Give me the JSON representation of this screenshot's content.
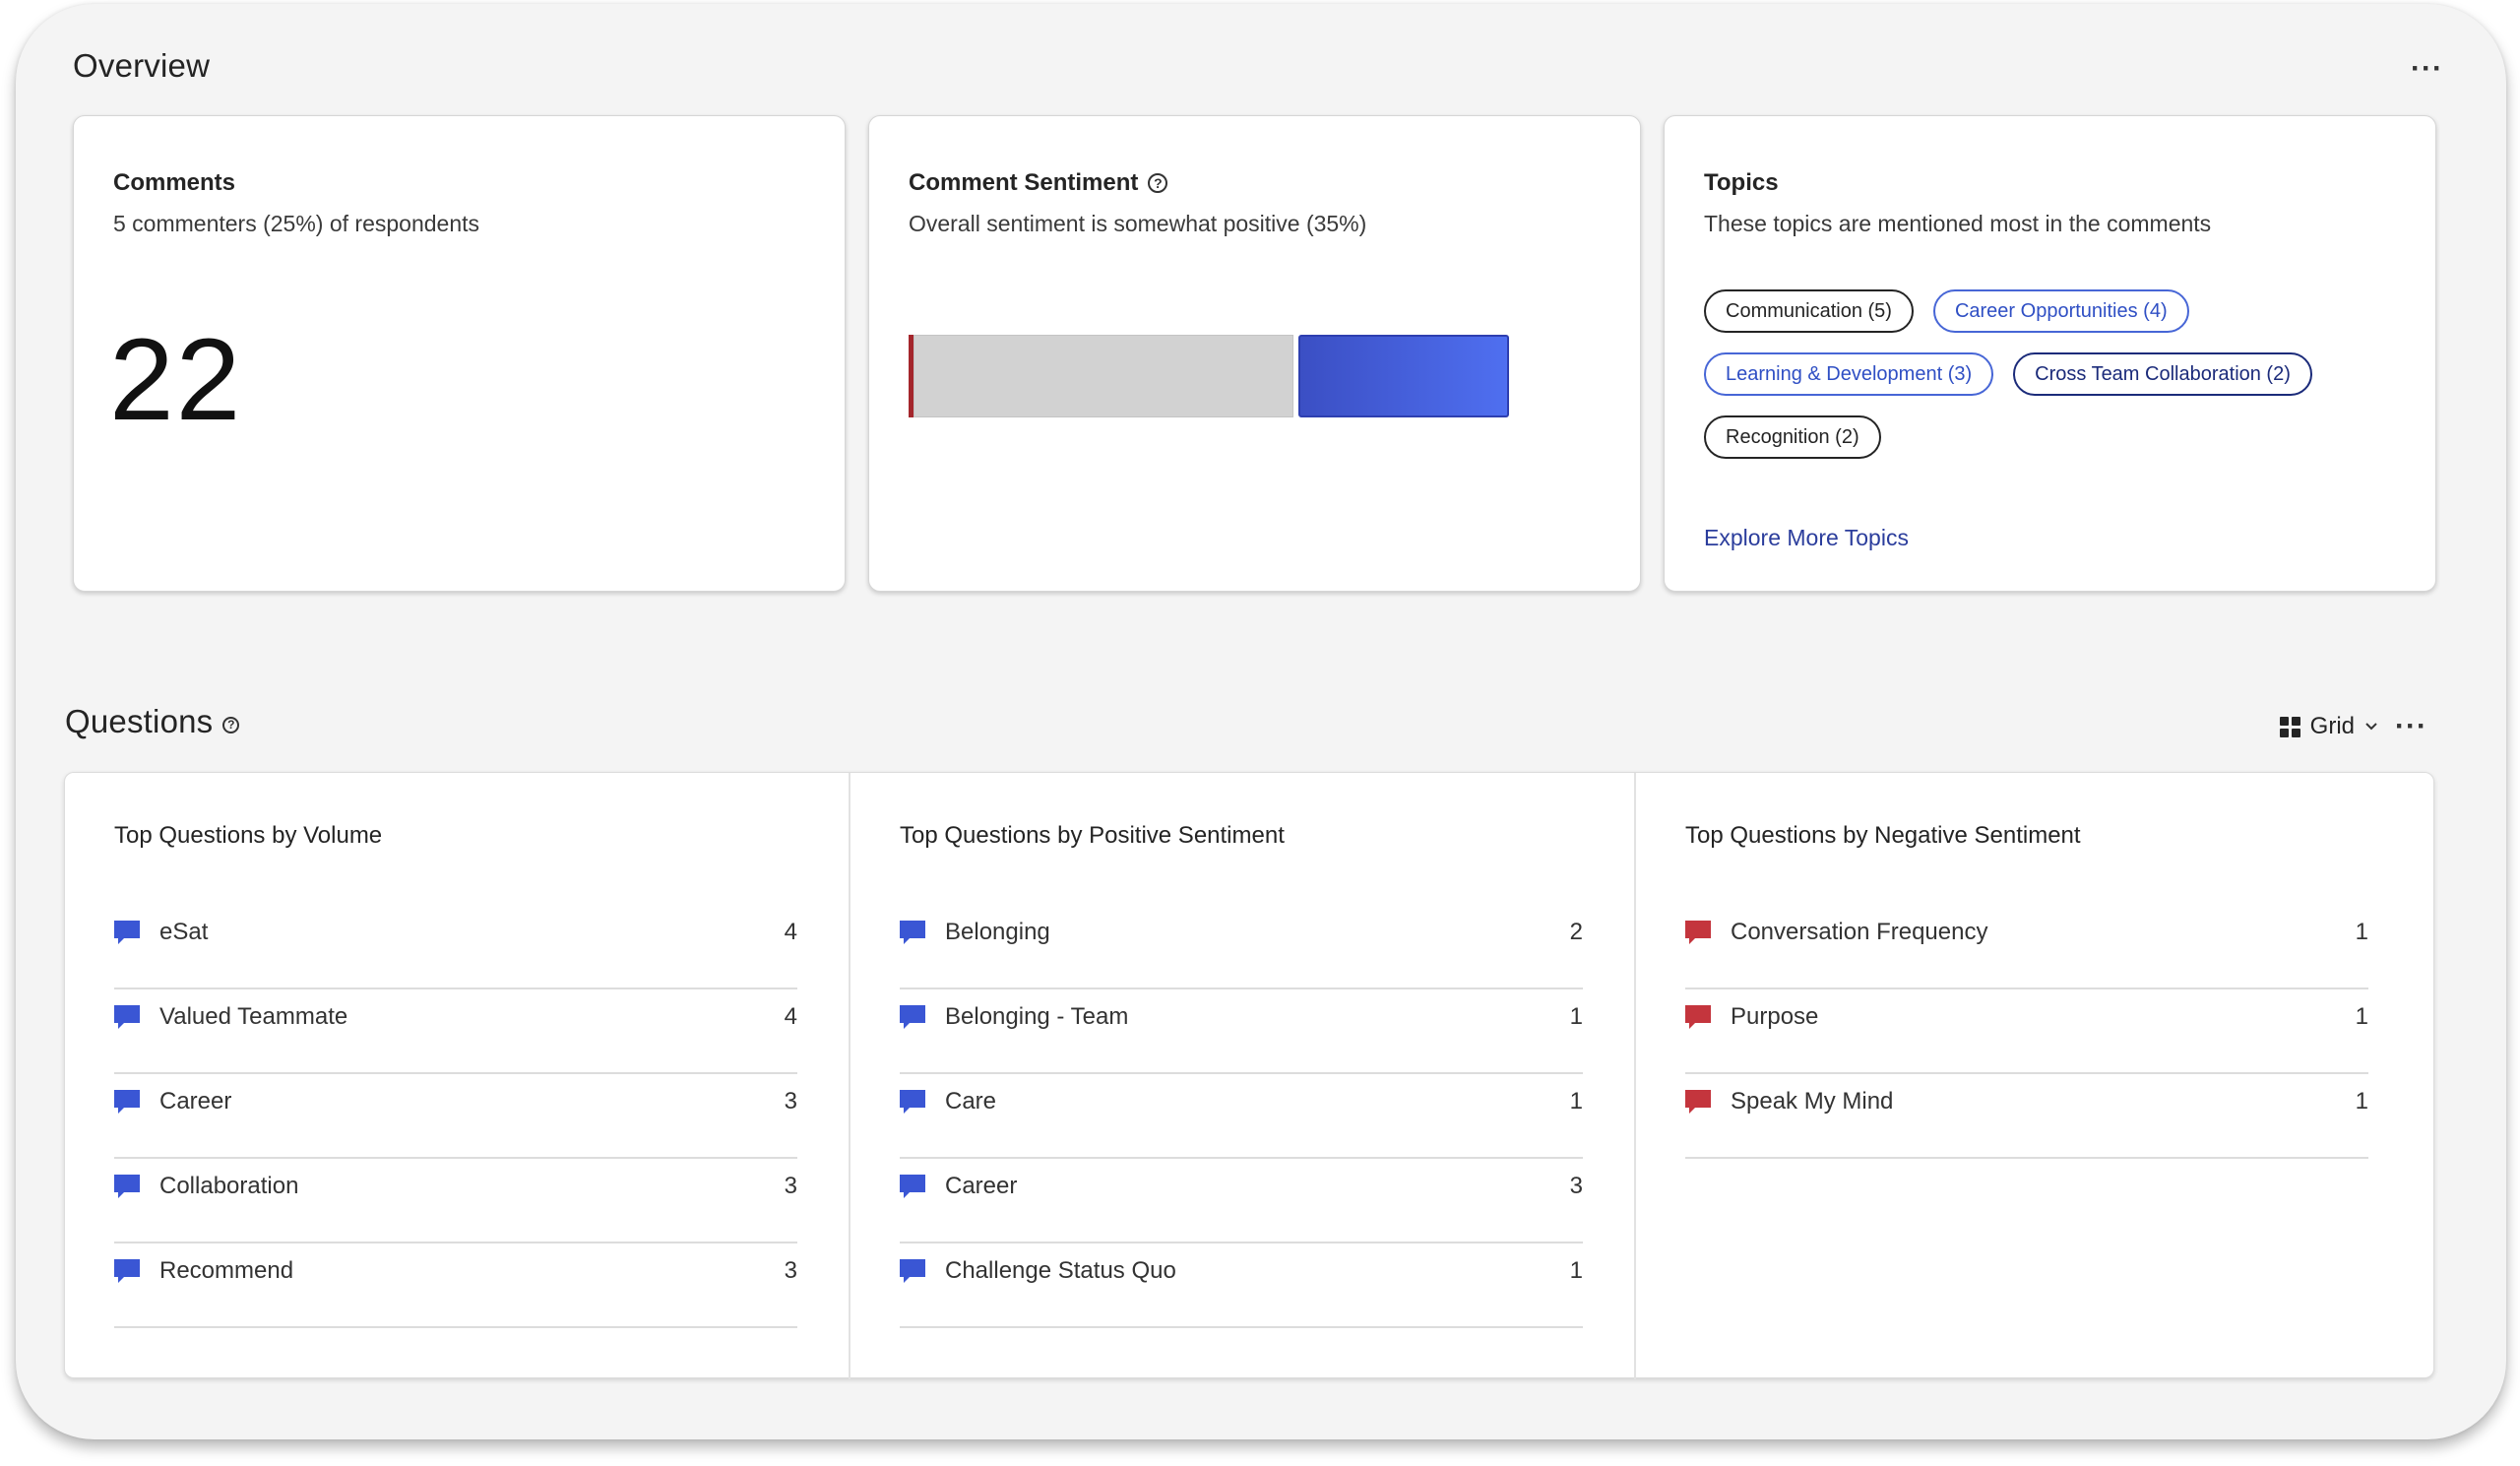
{
  "overview": {
    "title": "Overview",
    "more_label": "···"
  },
  "comments_card": {
    "title": "Comments",
    "subtitle": "5 commenters (25%) of respondents",
    "count": "22"
  },
  "sentiment_card": {
    "title": "Comment Sentiment",
    "help": "?",
    "subtitle": "Overall sentiment is somewhat positive (35%)",
    "bar_colors": {
      "negative": "#a4262c",
      "neutral": "#d2d2d2",
      "positive": "#4a63e0"
    }
  },
  "topics_card": {
    "title": "Topics",
    "subtitle": "These topics are mentioned most in the comments",
    "chips": [
      {
        "label": "Communication (5)",
        "style": "dark"
      },
      {
        "label": "Career Opportunities (4)",
        "style": "blue"
      },
      {
        "label": "Learning & Development (3)",
        "style": "blue"
      },
      {
        "label": "Cross Team Collaboration (2)",
        "style": "navy"
      },
      {
        "label": "Recognition (2)",
        "style": "dark"
      }
    ],
    "explore_link": "Explore More Topics"
  },
  "questions": {
    "title": "Questions",
    "help": "?",
    "view_label": "Grid",
    "more_label": "···",
    "columns": [
      {
        "title": "Top Questions by Volume",
        "icon_color": "#3a56d4",
        "items": [
          {
            "label": "eSat",
            "count": "4"
          },
          {
            "label": "Valued Teammate",
            "count": "4"
          },
          {
            "label": "Career",
            "count": "3"
          },
          {
            "label": "Collaboration",
            "count": "3"
          },
          {
            "label": "Recommend",
            "count": "3"
          }
        ]
      },
      {
        "title": "Top Questions by Positive Sentiment",
        "icon_color": "#3a56d4",
        "items": [
          {
            "label": "Belonging",
            "count": "2"
          },
          {
            "label": "Belonging - Team",
            "count": "1"
          },
          {
            "label": "Care",
            "count": "1"
          },
          {
            "label": "Career",
            "count": "3"
          },
          {
            "label": "Challenge Status Quo",
            "count": "1"
          }
        ]
      },
      {
        "title": "Top Questions by Negative Sentiment",
        "icon_color": "#c4353d",
        "items": [
          {
            "label": "Conversation Frequency",
            "count": "1"
          },
          {
            "label": "Purpose",
            "count": "1"
          },
          {
            "label": "Speak My Mind",
            "count": "1"
          }
        ]
      }
    ]
  }
}
